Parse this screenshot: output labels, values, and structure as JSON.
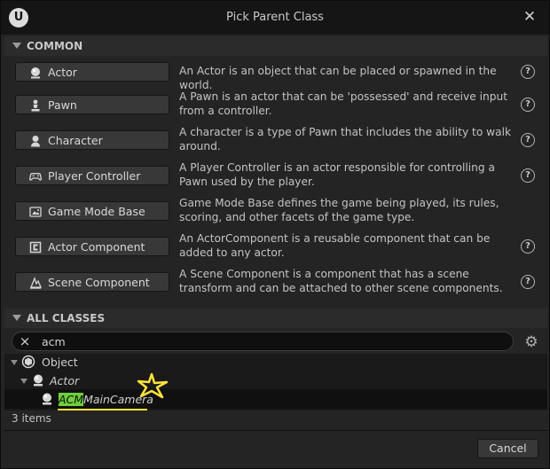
{
  "window": {
    "title": "Pick Parent Class",
    "logo": "U"
  },
  "common": {
    "header": "COMMON",
    "items": [
      {
        "label": "Actor",
        "icon": "actor-sphere-icon",
        "description": "An Actor is an object that can be placed or spawned in the world.",
        "help": "?"
      },
      {
        "label": "Pawn",
        "icon": "pawn-icon",
        "description": "A Pawn is an actor that can be 'possessed' and receive input from a controller.",
        "help": "?"
      },
      {
        "label": "Character",
        "icon": "character-icon",
        "description": "A character is a type of Pawn that includes the ability to walk around.",
        "help": "?"
      },
      {
        "label": "Player Controller",
        "icon": "gamepad-icon",
        "description": "A Player Controller is an actor responsible for controlling a Pawn used by the player.",
        "help": "?"
      },
      {
        "label": "Game Mode Base",
        "icon": "game-mode-icon",
        "description": "Game Mode Base defines the game being played, its rules, scoring, and other facets of the game type.",
        "help": ""
      },
      {
        "label": "Actor Component",
        "icon": "actor-component-icon",
        "description": "An ActorComponent is a reusable component that can be added to any actor.",
        "help": "?"
      },
      {
        "label": "Scene Component",
        "icon": "scene-component-icon",
        "description": "A Scene Component is a component that has a scene transform and can be attached to other scene components.",
        "help": "?"
      }
    ]
  },
  "all_classes": {
    "header": "ALL CLASSES",
    "search_value": "acm",
    "clear_icon": "×",
    "settings_icon": "⚙",
    "tree": [
      {
        "label": "Object"
      },
      {
        "label": "Actor"
      },
      {
        "match": "ACM",
        "rest": "MainCamera"
      }
    ],
    "item_count": "3 items"
  },
  "footer": {
    "cancel_label": "Cancel"
  },
  "colors": {
    "match_highlight": "#6fcf3c",
    "annotation": "#ffe43a"
  }
}
